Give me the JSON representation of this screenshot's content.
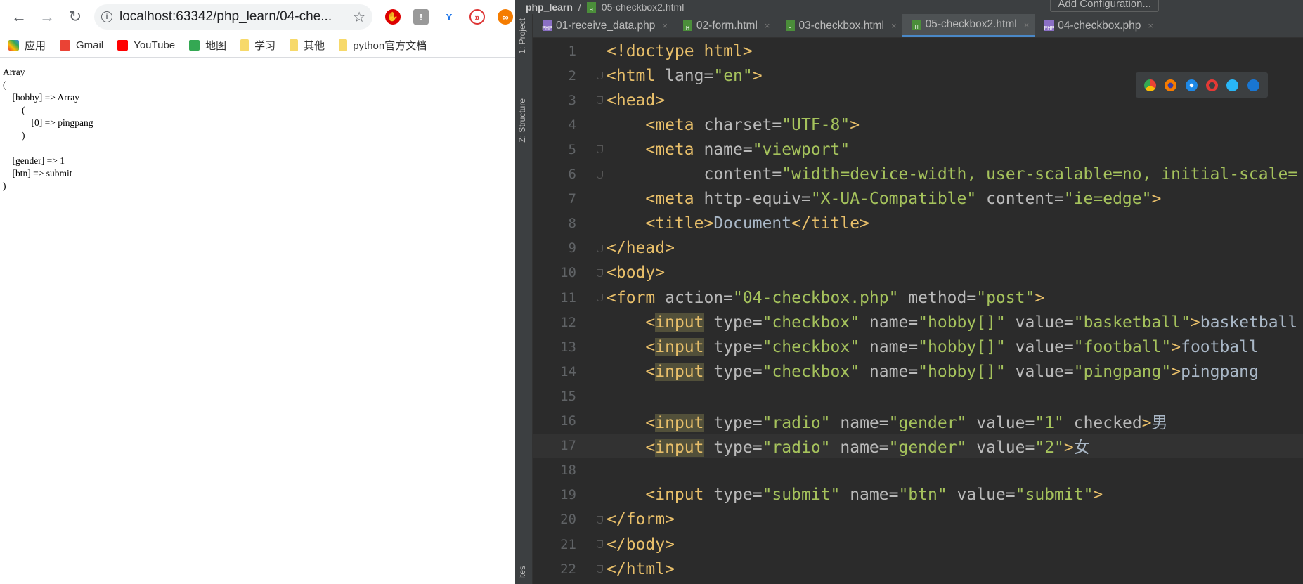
{
  "browser": {
    "url": "localhost:63342/php_learn/04-che...",
    "bookmarks": [
      {
        "label": "应用",
        "icon": "apps-grid-icon"
      },
      {
        "label": "Gmail",
        "icon": "gmail-icon"
      },
      {
        "label": "YouTube",
        "icon": "youtube-icon"
      },
      {
        "label": "地图",
        "icon": "maps-icon"
      },
      {
        "label": "学习",
        "icon": "folder-icon"
      },
      {
        "label": "其他",
        "icon": "folder-icon"
      },
      {
        "label": "python官方文档",
        "icon": "folder-icon"
      }
    ],
    "output": "Array\n(\n    [hobby] => Array\n        (\n            [0] => pingpang\n        )\n\n    [gender] => 1\n    [btn] => submit\n)"
  },
  "ide": {
    "breadcrumb": [
      "php_learn",
      "05-checkbox2.html"
    ],
    "add_configuration": "Add Configuration...",
    "side_labels": [
      "1: Project",
      "Z: Structure",
      "ites"
    ],
    "tabs": [
      {
        "label": "01-receive_data.php",
        "type": "php",
        "active": false
      },
      {
        "label": "02-form.html",
        "type": "html",
        "active": false
      },
      {
        "label": "03-checkbox.html",
        "type": "html",
        "active": false
      },
      {
        "label": "05-checkbox2.html",
        "type": "html",
        "active": true
      },
      {
        "label": "04-checkbox.php",
        "type": "php",
        "active": false
      }
    ],
    "current_line": 17,
    "lines": [
      [
        [
          "tag",
          "<!doctype html>"
        ]
      ],
      [
        [
          "tag",
          "<html "
        ],
        [
          "attr",
          "lang="
        ],
        [
          "str",
          "\"en\""
        ],
        [
          "tag",
          ">"
        ]
      ],
      [
        [
          "tag",
          "<head>"
        ]
      ],
      [
        [
          "text",
          "    "
        ],
        [
          "tag",
          "<meta "
        ],
        [
          "attr",
          "charset="
        ],
        [
          "str",
          "\"UTF-8\""
        ],
        [
          "tag",
          ">"
        ]
      ],
      [
        [
          "text",
          "    "
        ],
        [
          "tag",
          "<meta "
        ],
        [
          "attr",
          "name="
        ],
        [
          "str",
          "\"viewport\""
        ]
      ],
      [
        [
          "text",
          "          "
        ],
        [
          "attr",
          "content="
        ],
        [
          "str",
          "\"width=device-width, user-scalable=no, initial-scale="
        ]
      ],
      [
        [
          "text",
          "    "
        ],
        [
          "tag",
          "<meta "
        ],
        [
          "attr",
          "http-equiv="
        ],
        [
          "str",
          "\"X-UA-Compatible\" "
        ],
        [
          "attr",
          "content="
        ],
        [
          "str",
          "\"ie=edge\""
        ],
        [
          "tag",
          ">"
        ]
      ],
      [
        [
          "text",
          "    "
        ],
        [
          "tag",
          "<title>"
        ],
        [
          "text",
          "Document"
        ],
        [
          "tag",
          "</title>"
        ]
      ],
      [
        [
          "tag",
          "</head>"
        ]
      ],
      [
        [
          "tag",
          "<body>"
        ]
      ],
      [
        [
          "tag",
          "<form "
        ],
        [
          "attr",
          "action="
        ],
        [
          "str",
          "\"04-checkbox.php\" "
        ],
        [
          "attr",
          "method="
        ],
        [
          "str",
          "\"post\""
        ],
        [
          "tag",
          ">"
        ]
      ],
      [
        [
          "text",
          "    "
        ],
        [
          "tag",
          "<"
        ],
        [
          "hl",
          "input"
        ],
        [
          "attr",
          " type="
        ],
        [
          "str",
          "\"checkbox\" "
        ],
        [
          "attr",
          "name="
        ],
        [
          "str",
          "\"hobby[]\" "
        ],
        [
          "attr",
          "value="
        ],
        [
          "str",
          "\"basketball\""
        ],
        [
          "tag",
          ">"
        ],
        [
          "text",
          "basketball"
        ]
      ],
      [
        [
          "text",
          "    "
        ],
        [
          "tag",
          "<"
        ],
        [
          "hl",
          "input"
        ],
        [
          "attr",
          " type="
        ],
        [
          "str",
          "\"checkbox\" "
        ],
        [
          "attr",
          "name="
        ],
        [
          "str",
          "\"hobby[]\" "
        ],
        [
          "attr",
          "value="
        ],
        [
          "str",
          "\"football\""
        ],
        [
          "tag",
          ">"
        ],
        [
          "text",
          "football"
        ]
      ],
      [
        [
          "text",
          "    "
        ],
        [
          "tag",
          "<"
        ],
        [
          "hl",
          "input"
        ],
        [
          "attr",
          " type="
        ],
        [
          "str",
          "\"checkbox\" "
        ],
        [
          "attr",
          "name="
        ],
        [
          "str",
          "\"hobby[]\" "
        ],
        [
          "attr",
          "value="
        ],
        [
          "str",
          "\"pingpang\""
        ],
        [
          "tag",
          ">"
        ],
        [
          "text",
          "pingpang"
        ]
      ],
      [],
      [
        [
          "text",
          "    "
        ],
        [
          "tag",
          "<"
        ],
        [
          "hl",
          "input"
        ],
        [
          "attr",
          " type="
        ],
        [
          "str",
          "\"radio\" "
        ],
        [
          "attr",
          "name="
        ],
        [
          "str",
          "\"gender\" "
        ],
        [
          "attr",
          "value="
        ],
        [
          "str",
          "\"1\" "
        ],
        [
          "attr",
          "checked"
        ],
        [
          "tag",
          ">"
        ],
        [
          "text",
          "男"
        ]
      ],
      [
        [
          "text",
          "    "
        ],
        [
          "tag",
          "<"
        ],
        [
          "hl",
          "input"
        ],
        [
          "attr",
          " type="
        ],
        [
          "str",
          "\"radio\" "
        ],
        [
          "attr",
          "name="
        ],
        [
          "str",
          "\"gender\" "
        ],
        [
          "attr",
          "value="
        ],
        [
          "str",
          "\"2\""
        ],
        [
          "tag",
          ">"
        ],
        [
          "text",
          "女"
        ]
      ],
      [],
      [
        [
          "text",
          "    "
        ],
        [
          "tag",
          "<input "
        ],
        [
          "attr",
          "type="
        ],
        [
          "str",
          "\"submit\" "
        ],
        [
          "attr",
          "name="
        ],
        [
          "str",
          "\"btn\" "
        ],
        [
          "attr",
          "value="
        ],
        [
          "str",
          "\"submit\""
        ],
        [
          "tag",
          ">"
        ]
      ],
      [
        [
          "tag",
          "</form>"
        ]
      ],
      [
        [
          "tag",
          "</body>"
        ]
      ],
      [
        [
          "tag",
          "</html>"
        ]
      ]
    ],
    "fold_lines": [
      2,
      3,
      5,
      6,
      9,
      10,
      11,
      20,
      21,
      22
    ],
    "browser_icons": [
      "chrome-icon",
      "firefox-icon",
      "safari-icon",
      "opera-icon",
      "ie-icon",
      "edge-icon"
    ]
  }
}
